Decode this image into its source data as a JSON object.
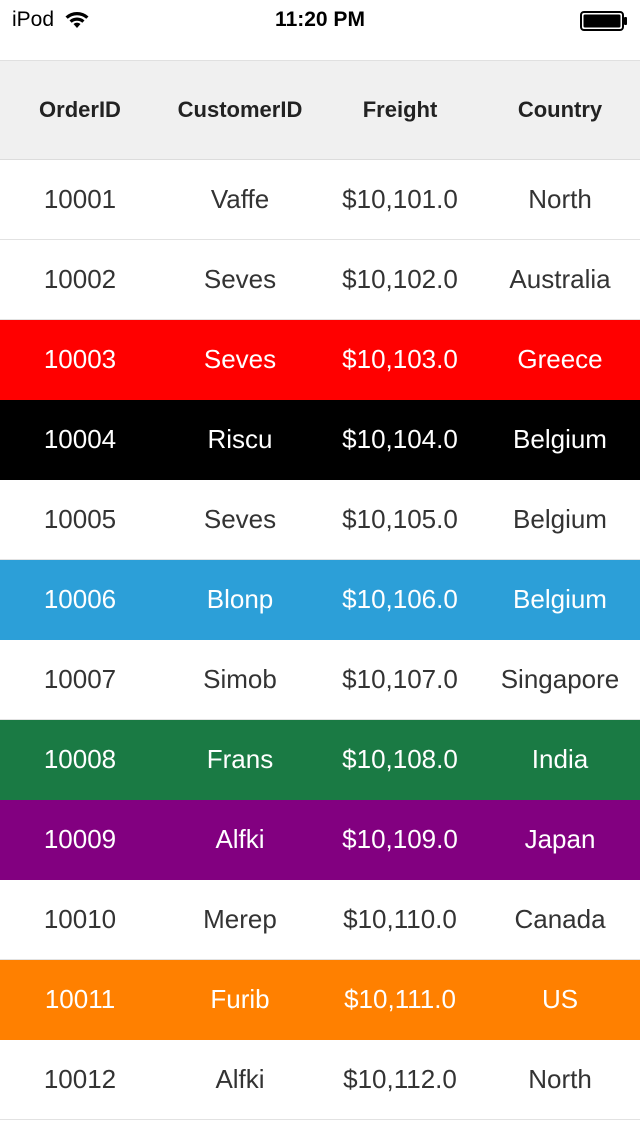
{
  "status_bar": {
    "device": "iPod",
    "time": "11:20 PM"
  },
  "grid": {
    "columns": [
      "OrderID",
      "CustomerID",
      "Freight",
      "Country"
    ],
    "rows": [
      {
        "order_id": "10001",
        "customer_id": "Vaffe",
        "freight": "$10,101.0",
        "country": "North",
        "bg": "#ffffff",
        "fg": "#333333"
      },
      {
        "order_id": "10002",
        "customer_id": "Seves",
        "freight": "$10,102.0",
        "country": "Australia",
        "bg": "#ffffff",
        "fg": "#333333"
      },
      {
        "order_id": "10003",
        "customer_id": "Seves",
        "freight": "$10,103.0",
        "country": "Greece",
        "bg": "#ff0000",
        "fg": "#ffffff"
      },
      {
        "order_id": "10004",
        "customer_id": "Riscu",
        "freight": "$10,104.0",
        "country": "Belgium",
        "bg": "#000000",
        "fg": "#ffffff"
      },
      {
        "order_id": "10005",
        "customer_id": "Seves",
        "freight": "$10,105.0",
        "country": "Belgium",
        "bg": "#ffffff",
        "fg": "#333333"
      },
      {
        "order_id": "10006",
        "customer_id": "Blonp",
        "freight": "$10,106.0",
        "country": "Belgium",
        "bg": "#2c9fd8",
        "fg": "#ffffff"
      },
      {
        "order_id": "10007",
        "customer_id": "Simob",
        "freight": "$10,107.0",
        "country": "Singapore",
        "bg": "#ffffff",
        "fg": "#333333"
      },
      {
        "order_id": "10008",
        "customer_id": "Frans",
        "freight": "$10,108.0",
        "country": "India",
        "bg": "#1a7a44",
        "fg": "#ffffff"
      },
      {
        "order_id": "10009",
        "customer_id": "Alfki",
        "freight": "$10,109.0",
        "country": "Japan",
        "bg": "#820080",
        "fg": "#ffffff"
      },
      {
        "order_id": "10010",
        "customer_id": "Merep",
        "freight": "$10,110.0",
        "country": "Canada",
        "bg": "#ffffff",
        "fg": "#333333"
      },
      {
        "order_id": "10011",
        "customer_id": "Furib",
        "freight": "$10,111.0",
        "country": "US",
        "bg": "#ff8000",
        "fg": "#ffffff"
      },
      {
        "order_id": "10012",
        "customer_id": "Alfki",
        "freight": "$10,112.0",
        "country": "North",
        "bg": "#ffffff",
        "fg": "#333333"
      }
    ]
  }
}
